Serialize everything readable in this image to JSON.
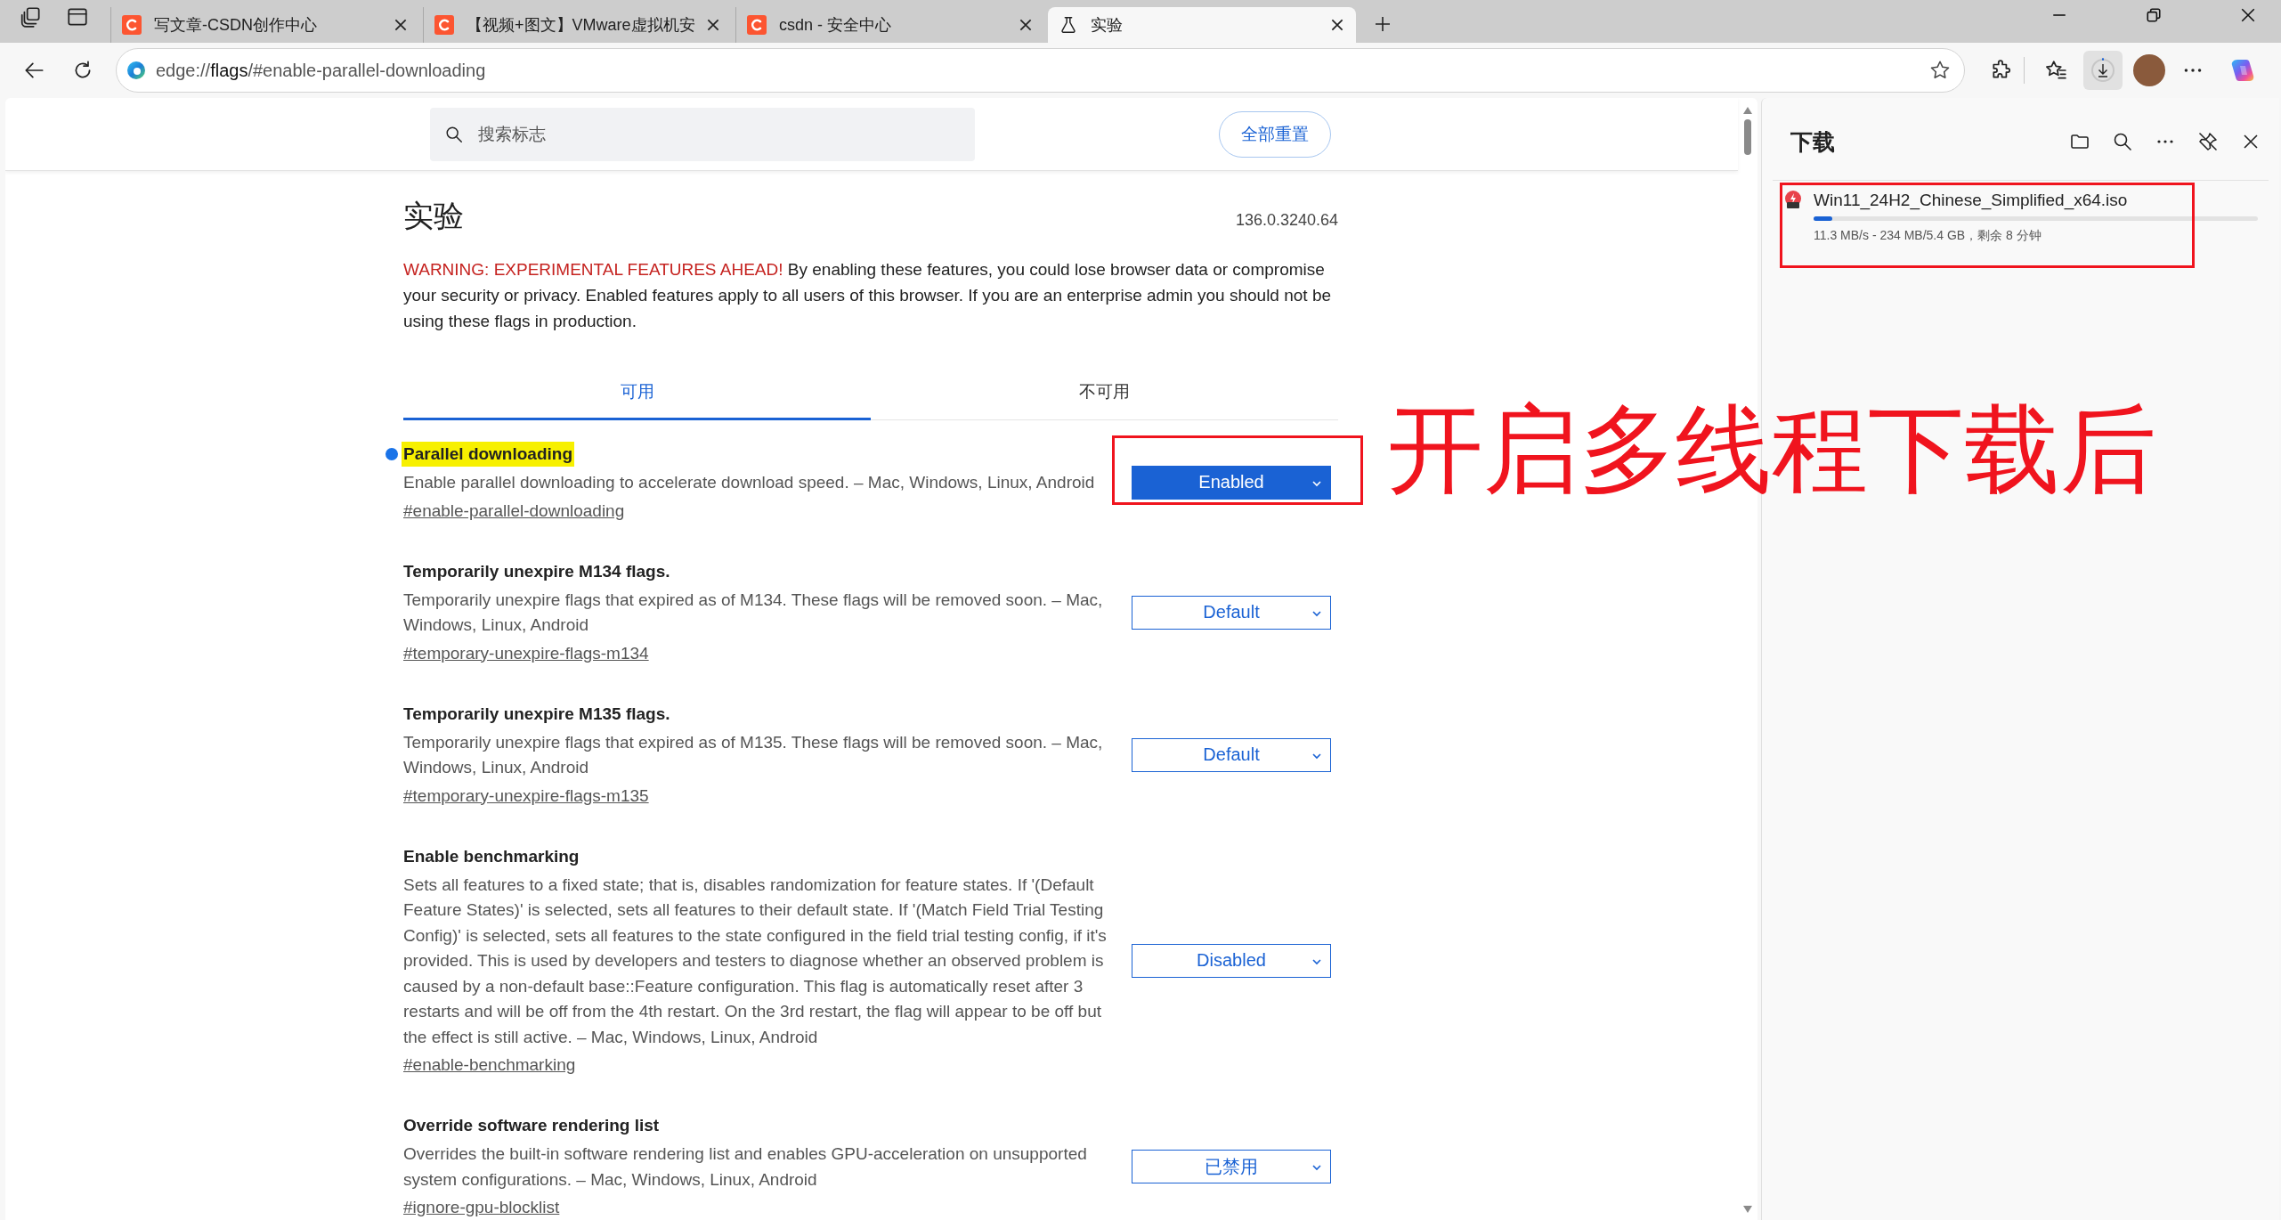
{
  "browser_tabs": [
    {
      "title": "写文章-CSDN创作中心",
      "selected": false,
      "kind": "site"
    },
    {
      "title": "【视频+图文】VMware虚拟机安",
      "selected": false,
      "kind": "site"
    },
    {
      "title": "csdn - 安全中心",
      "selected": false,
      "kind": "site"
    },
    {
      "title": "实验",
      "selected": true,
      "kind": "flask"
    }
  ],
  "address_bar": {
    "url": "edge://**flags**/#enable-parallel-downloading"
  },
  "flags_page": {
    "search": {
      "placeholder": "搜索标志"
    },
    "reset_button": "全部重置",
    "title": "实验",
    "version": "136.0.3240.64",
    "warning_label": "WARNING: EXPERIMENTAL FEATURES AHEAD!",
    "warning_text": "By enabling these features, you could lose browser data or compromise your security or privacy. Enabled features apply to all users of this browser. If you are an enterprise admin you should not be using these flags in production.",
    "tabs": [
      {
        "label": "可用",
        "selected": true
      },
      {
        "label": "不可用",
        "selected": false
      }
    ],
    "flags": [
      {
        "title": "Parallel downloading",
        "modified": true,
        "highlighted": true,
        "annotated": true,
        "description": "Enable parallel downloading to accelerate download speed. – Mac, Windows, Linux, Android",
        "link": "#enable-parallel-downloading",
        "value": "Enabled"
      },
      {
        "title": "Temporarily unexpire M134 flags.",
        "modified": false,
        "highlighted": false,
        "annotated": false,
        "description": "Temporarily unexpire flags that expired as of M134. These flags will be removed soon. – Mac, Windows, Linux, Android",
        "link": "#temporary-unexpire-flags-m134",
        "value": "Default"
      },
      {
        "title": "Temporarily unexpire M135 flags.",
        "modified": false,
        "highlighted": false,
        "annotated": false,
        "description": "Temporarily unexpire flags that expired as of M135. These flags will be removed soon. – Mac, Windows, Linux, Android",
        "link": "#temporary-unexpire-flags-m135",
        "value": "Default"
      },
      {
        "title": "Enable benchmarking",
        "modified": false,
        "highlighted": false,
        "annotated": false,
        "description": "Sets all features to a fixed state; that is, disables randomization for feature states. If '(Default Feature States)' is selected, sets all features to their default state. If '(Match Field Trial Testing Config)' is selected, sets all features to the state configured in the field trial testing config, if it's provided. This is used by developers and testers to diagnose whether an observed problem is caused by a non-default base::Feature configuration. This flag is automatically reset after 3 restarts and will be off from the 4th restart. On the 3rd restart, the flag will appear to be off but the effect is still active. – Mac, Windows, Linux, Android",
        "link": "#enable-benchmarking",
        "value": "Disabled"
      },
      {
        "title": "Override software rendering list",
        "modified": false,
        "highlighted": false,
        "annotated": false,
        "description": "Overrides the built-in software rendering list and enables GPU-acceleration on unsupported system configurations. – Mac, Windows, Linux, Android",
        "link": "#ignore-gpu-blocklist",
        "value": "已禁用"
      }
    ]
  },
  "downloads_panel": {
    "title": "下载",
    "items": [
      {
        "name": "Win11_24H2_Chinese_Simplified_x64.iso",
        "level": 0.043,
        "status": "11.3 MB/s - 234 MB/5.4 GB，剩余 8 分钟",
        "annotated": true
      }
    ]
  },
  "annotation_text": "开启多线程下载后"
}
